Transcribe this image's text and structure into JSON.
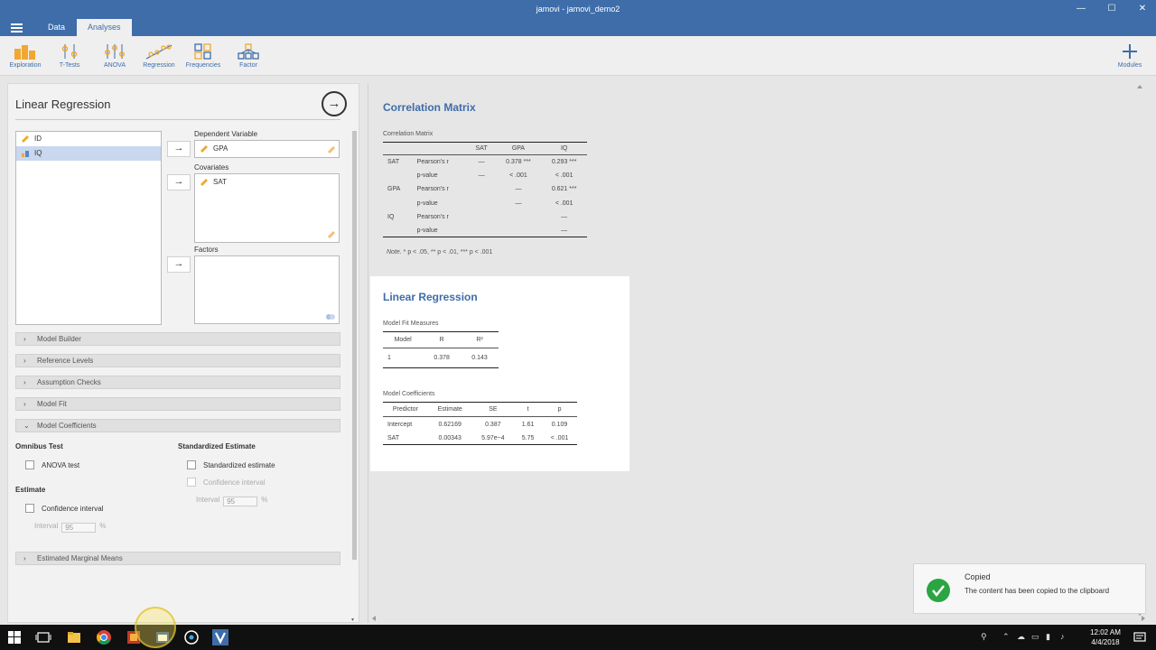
{
  "window": {
    "title": "jamovi - jamovi_demo2",
    "controls": {
      "minimize": "—",
      "maximize": "☐",
      "close": "✕"
    }
  },
  "tabs": [
    {
      "label": "Data",
      "active": false
    },
    {
      "label": "Analyses",
      "active": true
    }
  ],
  "ribbon": {
    "items": [
      "Exploration",
      "T-Tests",
      "ANOVA",
      "Regression",
      "Frequencies",
      "Factor"
    ],
    "modules_label": "Modules",
    "accent": "#3e6da9",
    "icon_color": "#f0a830"
  },
  "options": {
    "title": "Linear Regression",
    "variables": [
      {
        "name": "ID",
        "selected": false,
        "icon": "ruler-icon"
      },
      {
        "name": "IQ",
        "selected": true,
        "icon": "ordinal-icon"
      }
    ],
    "dependent": {
      "label": "Dependent Variable",
      "value": "GPA"
    },
    "covariates": {
      "label": "Covariates",
      "values": [
        "SAT"
      ]
    },
    "factors": {
      "label": "Factors"
    },
    "sections": {
      "model_builder": "Model Builder",
      "reference_levels": "Reference Levels",
      "assumption_checks": "Assumption Checks",
      "model_fit": "Model Fit",
      "model_coefficients": "Model Coefficients",
      "emm": "Estimated Marginal Means"
    },
    "coeffs": {
      "omnibus_head": "Omnibus Test",
      "anova_test": "ANOVA test",
      "std_head": "Standardized Estimate",
      "std_estimate": "Standardized estimate",
      "std_ci": "Confidence interval",
      "estimate_head": "Estimate",
      "est_ci": "Confidence interval",
      "interval_label": "Interval",
      "interval_value": "95",
      "pct": "%",
      "std_interval_label": "Interval",
      "std_interval_value": "95",
      "std_pct": "%"
    }
  },
  "results": {
    "corr": {
      "heading": "Correlation Matrix",
      "subtitle": "Correlation Matrix",
      "columns": [
        "",
        "",
        "SAT",
        "GPA",
        "IQ"
      ],
      "rows": [
        [
          "SAT",
          "Pearson's r",
          "—",
          "0.378 ***",
          "0.293 ***"
        ],
        [
          "",
          "p-value",
          "—",
          "< .001",
          "< .001"
        ],
        [
          "GPA",
          "Pearson's r",
          "",
          "—",
          "0.621 ***"
        ],
        [
          "",
          "p-value",
          "",
          "—",
          "< .001"
        ],
        [
          "IQ",
          "Pearson's r",
          "",
          "",
          "—"
        ],
        [
          "",
          "p-value",
          "",
          "",
          "—"
        ]
      ],
      "note_prefix": "Note.",
      "note_text": " * p < .05, ** p < .01, *** p < .001"
    },
    "lr": {
      "heading": "Linear Regression",
      "fit_title": "Model Fit Measures",
      "fit_columns": [
        "Model",
        "R",
        "R²"
      ],
      "fit_rows": [
        [
          "1",
          "0.378",
          "0.143"
        ]
      ],
      "coef_title": "Model Coefficients",
      "coef_columns": [
        "Predictor",
        "Estimate",
        "SE",
        "t",
        "p"
      ],
      "coef_rows": [
        [
          "Intercept",
          "0.62169",
          "0.387",
          "1.61",
          "0.109"
        ],
        [
          "SAT",
          "0.00343",
          "5.97e−4",
          "5.75",
          "< .001"
        ]
      ]
    }
  },
  "notification": {
    "title": "Copied",
    "message": "The content has been copied to the clipboard"
  },
  "taskbar": {
    "time": "12:02 AM",
    "date": "4/4/2018"
  }
}
